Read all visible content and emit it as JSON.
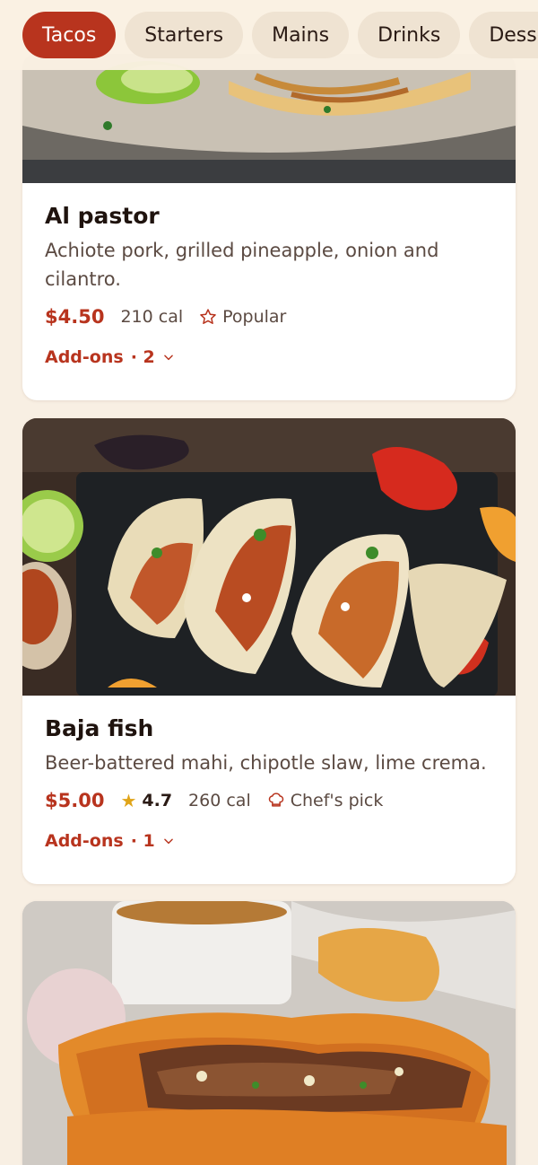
{
  "tabs": [
    {
      "label": "Tacos",
      "active": true
    },
    {
      "label": "Starters",
      "active": false
    },
    {
      "label": "Mains",
      "active": false
    },
    {
      "label": "Drinks",
      "active": false
    },
    {
      "label": "Desserts",
      "active": false
    }
  ],
  "items": [
    {
      "name": "Al pastor",
      "description": "Achiote pork, grilled pineapple, onion and cilantro.",
      "price": "$4.50",
      "calories": "210 cal",
      "badge": "Popular",
      "badge_icon": "star-outline-icon",
      "addons_label": "Add-ons",
      "addons_count": "· 2"
    },
    {
      "name": "Baja fish",
      "description": "Beer-battered mahi, chipotle slaw, lime crema.",
      "price": "$5.00",
      "rating": "4.7",
      "calories": "260 cal",
      "badge": "Chef's pick",
      "badge_icon": "chef-hat-icon",
      "addons_label": "Add-ons",
      "addons_count": "· 1"
    }
  ],
  "colors": {
    "accent": "#b8341e",
    "background": "#f8efe3",
    "rating_star": "#e0a418"
  }
}
